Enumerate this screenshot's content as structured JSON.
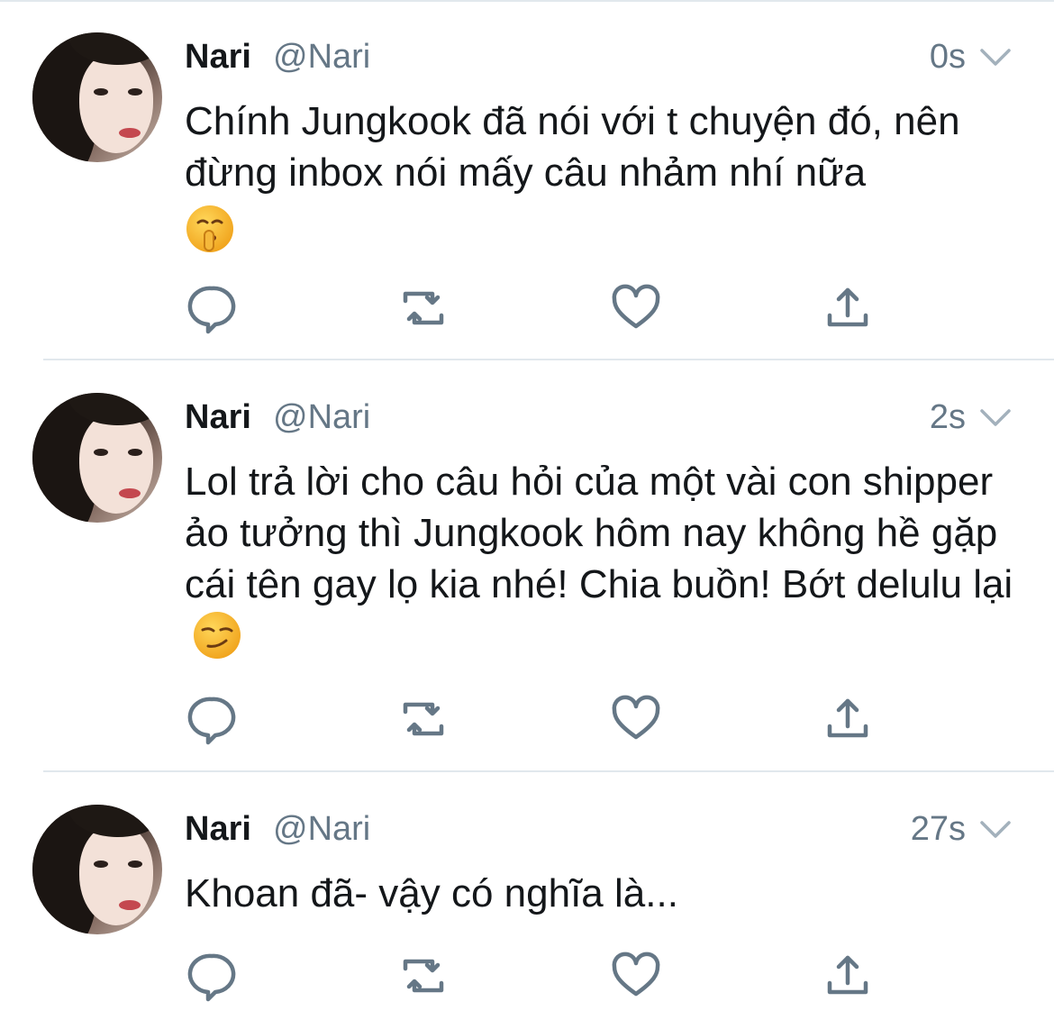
{
  "tweets": [
    {
      "name": "Nari",
      "handle": "@Nari",
      "time": "0s",
      "text": "Chính Jungkook đã nói với t chuyện đó, nên đừng inbox nói mấy câu nhảm nhí nữa",
      "emoji": "shushing-face"
    },
    {
      "name": "Nari",
      "handle": "@Nari",
      "time": "2s",
      "text": "Lol trả lời cho câu hỏi của một vài con shipper ảo tưởng thì Jungkook hôm nay không hề gặp cái tên gay lọ kia nhé! Chia buồn! Bớt delulu lại",
      "emoji": "smirking-face"
    },
    {
      "name": "Nari",
      "handle": "@Nari",
      "time": "27s",
      "text": "Khoan đã- vậy có nghĩa là...",
      "emoji": ""
    }
  ],
  "colors": {
    "text": "#14171a",
    "secondary": "#657786",
    "icon": "#657786",
    "divider": "#e1e8ed"
  },
  "icons": [
    "reply-icon",
    "retweet-icon",
    "like-icon",
    "share-icon",
    "chevron-down-icon"
  ]
}
